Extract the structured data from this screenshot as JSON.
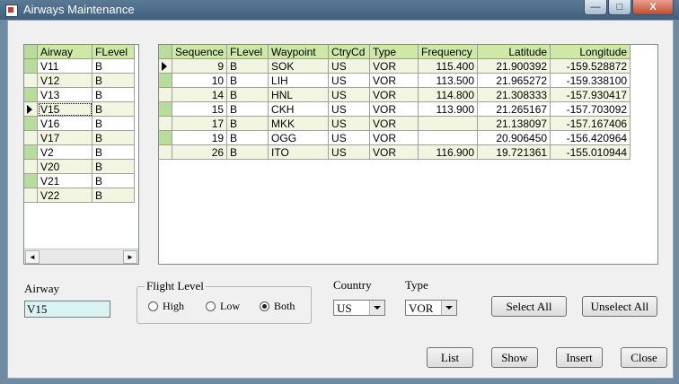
{
  "window": {
    "title": "Airways Maintenance",
    "min": "—",
    "max": "□",
    "close": "X"
  },
  "airway_grid": {
    "columns": [
      "Airway",
      "FLevel"
    ],
    "rows": [
      {
        "airway": "V11",
        "flevel": "B"
      },
      {
        "airway": "V12",
        "flevel": "B"
      },
      {
        "airway": "V13",
        "flevel": "B"
      },
      {
        "airway": "V15",
        "flevel": "B"
      },
      {
        "airway": "V16",
        "flevel": "B"
      },
      {
        "airway": "V17",
        "flevel": "B"
      },
      {
        "airway": "V2",
        "flevel": "B"
      },
      {
        "airway": "V20",
        "flevel": "B"
      },
      {
        "airway": "V21",
        "flevel": "B"
      },
      {
        "airway": "V22",
        "flevel": "B"
      }
    ],
    "selected_row": 3,
    "scroll_left": "◄",
    "scroll_right": "►"
  },
  "waypoint_grid": {
    "columns": [
      "Sequence",
      "FLevel",
      "Waypoint",
      "CtryCd",
      "Type",
      "Frequency",
      "Latitude",
      "Longitude"
    ],
    "rows": [
      {
        "sequence": "9",
        "flevel": "B",
        "waypoint": "SOK",
        "ctry": "US",
        "type": "VOR",
        "frequency": "115.400",
        "latitude": "21.900392",
        "longitude": "-159.528872"
      },
      {
        "sequence": "10",
        "flevel": "B",
        "waypoint": "LIH",
        "ctry": "US",
        "type": "VOR",
        "frequency": "113.500",
        "latitude": "21.965272",
        "longitude": "-159.338100"
      },
      {
        "sequence": "14",
        "flevel": "B",
        "waypoint": "HNL",
        "ctry": "US",
        "type": "VOR",
        "frequency": "114.800",
        "latitude": "21.308333",
        "longitude": "-157.930417"
      },
      {
        "sequence": "15",
        "flevel": "B",
        "waypoint": "CKH",
        "ctry": "US",
        "type": "VOR",
        "frequency": "113.900",
        "latitude": "21.265167",
        "longitude": "-157.703092"
      },
      {
        "sequence": "17",
        "flevel": "B",
        "waypoint": "MKK",
        "ctry": "US",
        "type": "VOR",
        "frequency": "",
        "latitude": "21.138097",
        "longitude": "-157.167406"
      },
      {
        "sequence": "19",
        "flevel": "B",
        "waypoint": "OGG",
        "ctry": "US",
        "type": "VOR",
        "frequency": "",
        "latitude": "20.906450",
        "longitude": "-156.420964"
      },
      {
        "sequence": "26",
        "flevel": "B",
        "waypoint": "ITO",
        "ctry": "US",
        "type": "VOR",
        "frequency": "116.900",
        "latitude": "19.721361",
        "longitude": "-155.010944"
      }
    ]
  },
  "airway_label": "Airway",
  "airway_value": "V15",
  "flight_level": {
    "title": "Flight Level",
    "options": [
      "High",
      "Low",
      "Both"
    ],
    "selected": "Both"
  },
  "country": {
    "label": "Country",
    "value": "US"
  },
  "type": {
    "label": "Type",
    "value": "VOR"
  },
  "buttons": {
    "select_all": "Select All",
    "unselect_all": "Unselect All",
    "list": "List",
    "show": "Show",
    "insert": "Insert",
    "close": "Close"
  }
}
